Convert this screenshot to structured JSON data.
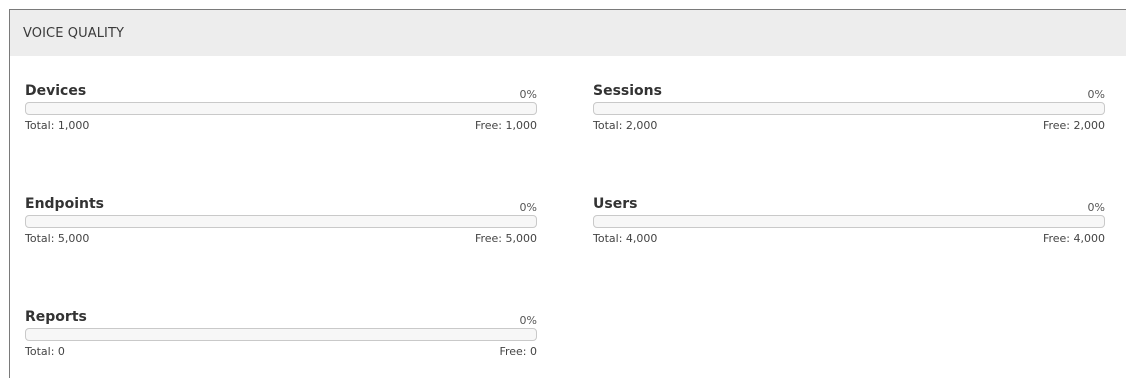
{
  "panel": {
    "title": "VOICE QUALITY"
  },
  "metrics": [
    {
      "title": "Devices",
      "percent": "0%",
      "fill": 0,
      "total": "Total: 1,000",
      "free": "Free: 1,000"
    },
    {
      "title": "Sessions",
      "percent": "0%",
      "fill": 0,
      "total": "Total: 2,000",
      "free": "Free: 2,000"
    },
    {
      "title": "Endpoints",
      "percent": "0%",
      "fill": 0,
      "total": "Total: 5,000",
      "free": "Free: 5,000"
    },
    {
      "title": "Users",
      "percent": "0%",
      "fill": 0,
      "total": "Total: 4,000",
      "free": "Free: 4,000"
    },
    {
      "title": "Reports",
      "percent": "0%",
      "fill": 0,
      "total": "Total: 0",
      "free": "Free: 0"
    }
  ],
  "colors": {
    "header_bg": "#ededed",
    "bar_bg": "#f7f7f7",
    "bar_border": "#c9c9c9",
    "bar_fill": "#4a90c8"
  }
}
